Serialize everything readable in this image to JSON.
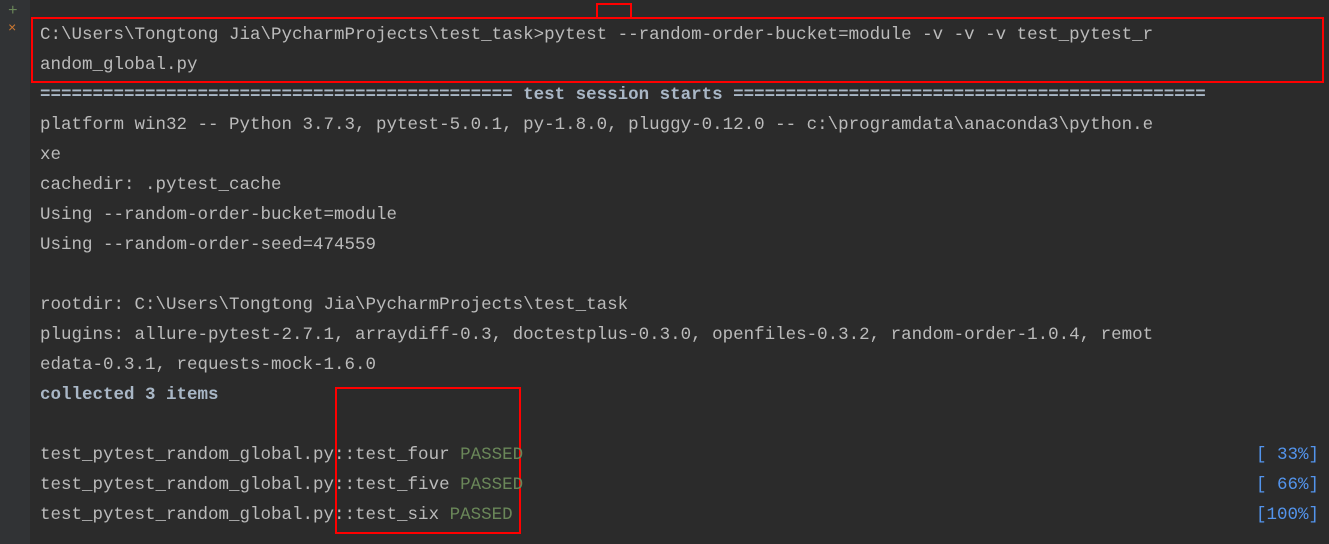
{
  "gutter": {
    "plus": "+",
    "x": "×"
  },
  "command": {
    "line1": "C:\\Users\\Tongtong Jia\\PycharmProjects\\test_task>pytest --random-order-bucket=module -v -v -v test_pytest_r",
    "line2": "andom_global.py"
  },
  "session": {
    "header_left": "============================================= ",
    "header_title": "test session starts",
    "header_right": " =============================================",
    "platform_line1": "platform win32 -- Python 3.7.3, pytest-5.0.1, py-1.8.0, pluggy-0.12.0 -- c:\\programdata\\anaconda3\\python.e",
    "platform_line2": "xe",
    "cachedir": "cachedir: .pytest_cache",
    "using_bucket": "Using --random-order-bucket=module",
    "using_seed": "Using --random-order-seed=474559",
    "rootdir": "rootdir: C:\\Users\\Tongtong Jia\\PycharmProjects\\test_task",
    "plugins_line1": "plugins: allure-pytest-2.7.1, arraydiff-0.3, doctestplus-0.3.0, openfiles-0.3.2, random-order-1.0.4, remot",
    "plugins_line2": "edata-0.3.1, requests-mock-1.6.0",
    "collected": "collected 3 items"
  },
  "tests": [
    {
      "name": "test_pytest_random_global.py::test_four ",
      "status": "PASSED",
      "percent": "[ 33%]"
    },
    {
      "name": "test_pytest_random_global.py::test_five ",
      "status": "PASSED",
      "percent": "[ 66%]"
    },
    {
      "name": "test_pytest_random_global.py::test_six ",
      "status": "PASSED",
      "percent": "[100%]"
    }
  ]
}
